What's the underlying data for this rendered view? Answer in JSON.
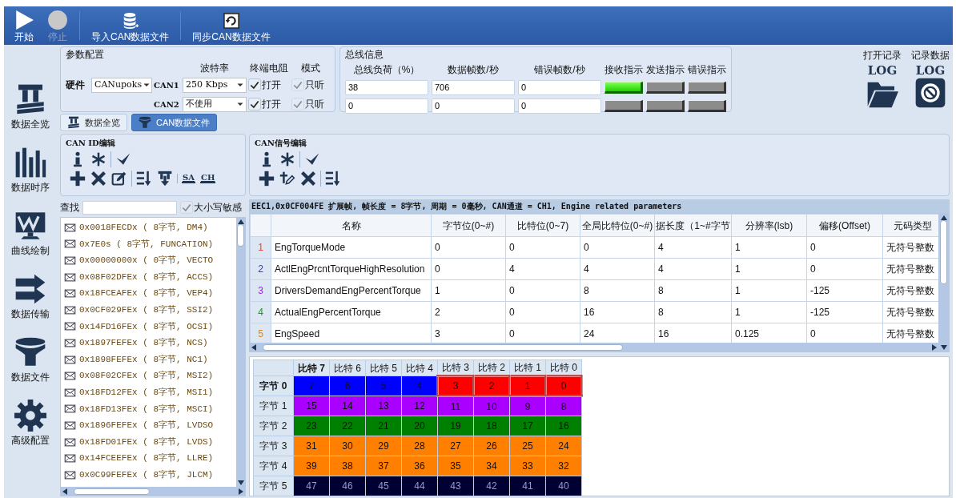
{
  "toolbar": [
    {
      "label": "开始",
      "kind": "play",
      "disabled": false
    },
    {
      "label": "停止",
      "kind": "stop",
      "disabled": true
    },
    {
      "label": "导入CAN数据文件",
      "kind": "database",
      "disabled": false
    },
    {
      "label": "同步CAN数据文件",
      "kind": "sync",
      "disabled": false
    }
  ],
  "sidebar": {
    "items": [
      {
        "label": "数据全览",
        "kind": "layers"
      },
      {
        "label": "数据时序",
        "kind": "bars"
      },
      {
        "label": "曲线绘制",
        "kind": "monitor"
      },
      {
        "label": "数据传输",
        "kind": "arrows"
      },
      {
        "label": "数据文件",
        "kind": "funnel"
      },
      {
        "label": "高级配置",
        "kind": "gear"
      }
    ]
  },
  "params": {
    "title": "参数配置",
    "headers": [
      "波特率",
      "终端电阻",
      "模式"
    ],
    "hardware_label": "硬件",
    "hardware": "CANupoks",
    "channels": [
      {
        "name": "CAN1",
        "baud": "250 Kbps",
        "terminator": {
          "label": "打开",
          "checked": true,
          "disabled": false
        },
        "listen": {
          "label": "只听",
          "checked": true,
          "disabled": true
        }
      },
      {
        "name": "CAN2",
        "baud": "不使用",
        "terminator": {
          "label": "打开",
          "checked": true,
          "disabled": false
        },
        "listen": {
          "label": "只听",
          "checked": true,
          "disabled": true
        }
      }
    ]
  },
  "bus": {
    "title": "总线信息",
    "headers": [
      "总线负荷（%）",
      "数据帧数/秒",
      "错误帧数/秒",
      "接收指示",
      "发送指示",
      "错误指示"
    ],
    "rows": [
      {
        "values": [
          "38",
          "706",
          "0"
        ],
        "indicators": [
          {
            "on": true
          },
          {
            "on": false
          },
          {
            "on": false
          }
        ]
      },
      {
        "values": [
          "0",
          "0",
          "0"
        ],
        "indicators": [
          {
            "on": false
          },
          {
            "on": false
          },
          {
            "on": false
          }
        ]
      }
    ]
  },
  "log": [
    {
      "label": "打开记录",
      "logo": "LOG",
      "kind": "folder"
    },
    {
      "label": "记录数据",
      "logo": "LOG",
      "kind": "disc"
    }
  ],
  "tabs": [
    {
      "label": "数据全览",
      "kind": "layers",
      "selected": false
    },
    {
      "label": "CAN数据文件",
      "kind": "funnel",
      "selected": true
    }
  ],
  "id_editor": {
    "title": "CAN ID编辑",
    "tools": [
      [
        [
          {
            "kind": "info"
          },
          {
            "kind": "star"
          }
        ],
        [
          {
            "kind": "check"
          }
        ]
      ],
      [
        [
          {
            "kind": "plus"
          },
          {
            "kind": "x"
          },
          {
            "kind": "edit"
          }
        ],
        [
          {
            "kind": "sortaz"
          },
          {
            "kind": "sortdown"
          }
        ],
        [
          {
            "kind": "text",
            "label": "SA"
          },
          {
            "kind": "text",
            "label": "CH"
          }
        ]
      ]
    ],
    "search": {
      "label": "查找",
      "case_sensitive": {
        "label": "大小写敏感",
        "checked": true,
        "disabled": true
      }
    },
    "ids": [
      "0x0018FECDx ( 8字节, DM4)",
      "0x7E0s ( 8字节, FUNCATION)",
      "0x00000000x ( 0字节, VECTO",
      "0x08F02DFEx ( 8字节, ACCS)",
      "0x18FCEAFEx ( 8字节, VEP4)",
      "0x0CF029FEx ( 8字节, SSI2)",
      "0x14FD16FEx ( 8字节, OCSI)",
      "0x1897FEFEx ( 8字节, NCS)",
      "0x1898FEFEx ( 8字节, NC1)",
      "0x08F02CFEx ( 8字节, MSI2)",
      "0x18FD12FEx ( 8字节, MSI1)",
      "0x18FD13FEx ( 8字节, MSCI)",
      "0x1896FEFEx ( 8字节, LVDSO",
      "0x18FD01FEx ( 8字节, LVDS)",
      "0x14FCEEFEx ( 8字节, LLRE)",
      "0x0C99FEFEx ( 8字节, JLCM)"
    ]
  },
  "signal_editor": {
    "title": "CAN信号编辑",
    "tools": [
      [
        [
          {
            "kind": "info"
          },
          {
            "kind": "star"
          }
        ],
        [
          {
            "kind": "check"
          }
        ]
      ],
      [
        [
          {
            "kind": "plus"
          },
          {
            "kind": "addedit"
          },
          {
            "kind": "x"
          }
        ],
        [
          {
            "kind": "sortaz"
          }
        ]
      ]
    ]
  },
  "info_bar": "EEC1,0x0CF004FE 扩展帧, 帧长度 = 8字节, 周期 = 0毫秒, CAN通道 = CH1, Engine related parameters",
  "table": {
    "columns": [
      "名称",
      "字节位(0~#)",
      "比特位(0~7)",
      "全局比特位(0~#)",
      "据长度（1~#字节",
      "分辨率(lsb)",
      "偏移(Offset)",
      "元码类型"
    ],
    "rows": [
      {
        "index": "1",
        "color": "#e8402a",
        "cells": [
          "EngTorqueMode",
          "0",
          "0",
          "0",
          "4",
          "1",
          "0",
          "无符号整数"
        ]
      },
      {
        "index": "2",
        "color": "#1c3cff",
        "cells": [
          "ActlEngPrcntTorqueHighResolution",
          "0",
          "4",
          "4",
          "4",
          "1",
          "0",
          "无符号整数"
        ]
      },
      {
        "index": "3",
        "color": "#a020f0",
        "cells": [
          "DriversDemandEngPercentTorque",
          "1",
          "0",
          "8",
          "8",
          "1",
          "-125",
          "无符号整数"
        ]
      },
      {
        "index": "4",
        "color": "#1a9a1a",
        "cells": [
          "ActualEngPercentTorque",
          "2",
          "0",
          "16",
          "8",
          "1",
          "-125",
          "无符号整数"
        ]
      },
      {
        "index": "5",
        "color": "#f08000",
        "cells": [
          "EngSpeed",
          "3",
          "0",
          "24",
          "16",
          "0.125",
          "0",
          "无符号整数"
        ]
      }
    ]
  },
  "bit_grid": {
    "columns": [
      {
        "label": "比特 7",
        "selected": true
      },
      {
        "label": "比特 6",
        "selected": false
      },
      {
        "label": "比特 5",
        "selected": false
      },
      {
        "label": "比特 4",
        "selected": false
      },
      {
        "label": "比特 3",
        "selected": false
      },
      {
        "label": "比特 2",
        "selected": false
      },
      {
        "label": "比特 1",
        "selected": false
      },
      {
        "label": "比特 0",
        "selected": false
      }
    ],
    "rows": [
      {
        "label": "字节 0",
        "selected": true,
        "cells": [
          {
            "text": "7",
            "color": "#0000ff",
            "selected": false
          },
          {
            "text": "6",
            "color": "#0000ff",
            "selected": false
          },
          {
            "text": "5",
            "color": "#0000ff",
            "selected": false
          },
          {
            "text": "4",
            "color": "#0000ff",
            "selected": false
          },
          {
            "text": "3",
            "color": "#ff0000",
            "selected": true
          },
          {
            "text": "2",
            "color": "#ff0000",
            "selected": true
          },
          {
            "text": "1",
            "color": "#ff0000",
            "selected": true
          },
          {
            "text": "0",
            "color": "#ff0000",
            "selected": true
          }
        ]
      },
      {
        "label": "字节 1",
        "selected": false,
        "cells": [
          {
            "text": "15",
            "color": "#aa00ff",
            "selected": false
          },
          {
            "text": "14",
            "color": "#aa00ff",
            "selected": false
          },
          {
            "text": "13",
            "color": "#aa00ff",
            "selected": false
          },
          {
            "text": "12",
            "color": "#aa00ff",
            "selected": false
          },
          {
            "text": "11",
            "color": "#aa00ff",
            "selected": false
          },
          {
            "text": "10",
            "color": "#aa00ff",
            "selected": false
          },
          {
            "text": "9",
            "color": "#aa00ff",
            "selected": false
          },
          {
            "text": "8",
            "color": "#aa00ff",
            "selected": false
          }
        ]
      },
      {
        "label": "字节 2",
        "selected": false,
        "cells": [
          {
            "text": "23",
            "color": "#008000",
            "selected": false
          },
          {
            "text": "22",
            "color": "#008000",
            "selected": false
          },
          {
            "text": "21",
            "color": "#008000",
            "selected": false
          },
          {
            "text": "20",
            "color": "#008000",
            "selected": false
          },
          {
            "text": "19",
            "color": "#008000",
            "selected": false
          },
          {
            "text": "18",
            "color": "#008000",
            "selected": false
          },
          {
            "text": "17",
            "color": "#008000",
            "selected": false
          },
          {
            "text": "16",
            "color": "#008000",
            "selected": false
          }
        ]
      },
      {
        "label": "字节 3",
        "selected": false,
        "cells": [
          {
            "text": "31",
            "color": "#ff8000",
            "selected": false
          },
          {
            "text": "30",
            "color": "#ff8000",
            "selected": false
          },
          {
            "text": "29",
            "color": "#ff8000",
            "selected": false
          },
          {
            "text": "28",
            "color": "#ff8000",
            "selected": false
          },
          {
            "text": "27",
            "color": "#ff8000",
            "selected": false
          },
          {
            "text": "26",
            "color": "#ff8000",
            "selected": false
          },
          {
            "text": "25",
            "color": "#ff8000",
            "selected": false
          },
          {
            "text": "24",
            "color": "#ff8000",
            "selected": false
          }
        ]
      },
      {
        "label": "字节 4",
        "selected": false,
        "cells": [
          {
            "text": "39",
            "color": "#ff8000",
            "selected": false
          },
          {
            "text": "38",
            "color": "#ff8000",
            "selected": false
          },
          {
            "text": "37",
            "color": "#ff8000",
            "selected": false
          },
          {
            "text": "36",
            "color": "#ff8000",
            "selected": false
          },
          {
            "text": "35",
            "color": "#ff8000",
            "selected": false
          },
          {
            "text": "34",
            "color": "#ff8000",
            "selected": false
          },
          {
            "text": "33",
            "color": "#ff8000",
            "selected": false
          },
          {
            "text": "32",
            "color": "#ff8000",
            "selected": false
          }
        ]
      },
      {
        "label": "字节 5",
        "selected": false,
        "cells": [
          {
            "text": "47",
            "color": "#000033",
            "selected": false
          },
          {
            "text": "46",
            "color": "#000033",
            "selected": false
          },
          {
            "text": "45",
            "color": "#000033",
            "selected": false
          },
          {
            "text": "44",
            "color": "#000033",
            "selected": false
          },
          {
            "text": "43",
            "color": "#000033",
            "selected": false
          },
          {
            "text": "42",
            "color": "#000033",
            "selected": false
          },
          {
            "text": "41",
            "color": "#000033",
            "selected": false
          },
          {
            "text": "40",
            "color": "#000033",
            "selected": false
          }
        ]
      }
    ]
  }
}
